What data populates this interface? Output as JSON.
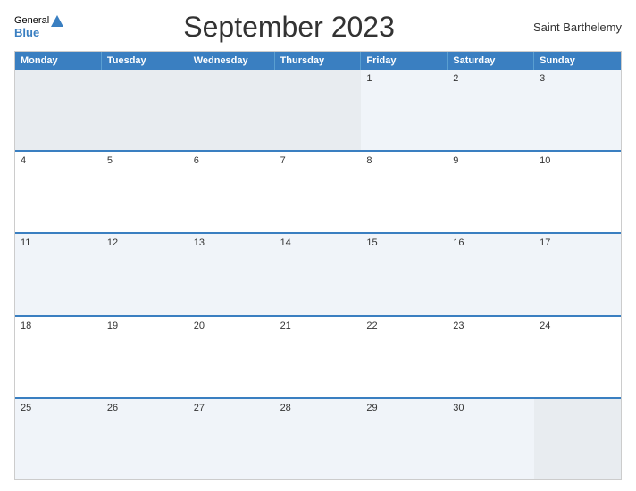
{
  "header": {
    "title": "September 2023",
    "region": "Saint Barthelemy",
    "logo_general": "General",
    "logo_blue": "Blue"
  },
  "days_of_week": [
    "Monday",
    "Tuesday",
    "Wednesday",
    "Thursday",
    "Friday",
    "Saturday",
    "Sunday"
  ],
  "weeks": [
    [
      {
        "day": "",
        "empty": true
      },
      {
        "day": "",
        "empty": true
      },
      {
        "day": "",
        "empty": true
      },
      {
        "day": "",
        "empty": true
      },
      {
        "day": "1",
        "empty": false
      },
      {
        "day": "2",
        "empty": false
      },
      {
        "day": "3",
        "empty": false
      }
    ],
    [
      {
        "day": "4",
        "empty": false
      },
      {
        "day": "5",
        "empty": false
      },
      {
        "day": "6",
        "empty": false
      },
      {
        "day": "7",
        "empty": false
      },
      {
        "day": "8",
        "empty": false
      },
      {
        "day": "9",
        "empty": false
      },
      {
        "day": "10",
        "empty": false
      }
    ],
    [
      {
        "day": "11",
        "empty": false
      },
      {
        "day": "12",
        "empty": false
      },
      {
        "day": "13",
        "empty": false
      },
      {
        "day": "14",
        "empty": false
      },
      {
        "day": "15",
        "empty": false
      },
      {
        "day": "16",
        "empty": false
      },
      {
        "day": "17",
        "empty": false
      }
    ],
    [
      {
        "day": "18",
        "empty": false
      },
      {
        "day": "19",
        "empty": false
      },
      {
        "day": "20",
        "empty": false
      },
      {
        "day": "21",
        "empty": false
      },
      {
        "day": "22",
        "empty": false
      },
      {
        "day": "23",
        "empty": false
      },
      {
        "day": "24",
        "empty": false
      }
    ],
    [
      {
        "day": "25",
        "empty": false
      },
      {
        "day": "26",
        "empty": false
      },
      {
        "day": "27",
        "empty": false
      },
      {
        "day": "28",
        "empty": false
      },
      {
        "day": "29",
        "empty": false
      },
      {
        "day": "30",
        "empty": false
      },
      {
        "day": "",
        "empty": true
      }
    ]
  ],
  "colors": {
    "header_bg": "#3a7fc1",
    "accent": "#3a7fc1",
    "row_odd": "#f0f4f9",
    "row_even": "#ffffff"
  }
}
